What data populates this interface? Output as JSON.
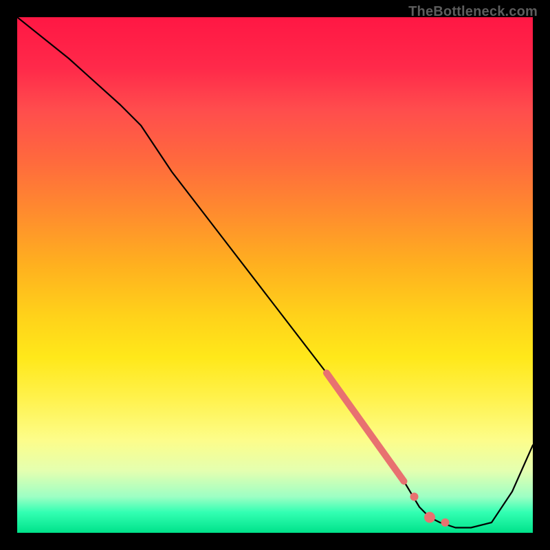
{
  "watermark": "TheBottleneck.com",
  "chart_data": {
    "type": "line",
    "xlim": [
      0,
      100
    ],
    "ylim": [
      0,
      100
    ],
    "grid": false,
    "legend": false,
    "title": "",
    "xlabel": "",
    "ylabel": "",
    "series": [
      {
        "name": "curve",
        "x": [
          0,
          10,
          20,
          24,
          30,
          40,
          50,
          60,
          68,
          72,
          75,
          78,
          80,
          82,
          85,
          88,
          92,
          96,
          100
        ],
        "y": [
          100,
          92,
          83,
          79,
          70,
          57,
          44,
          31,
          20,
          14,
          10,
          5,
          3,
          2,
          1,
          1,
          2,
          8,
          17
        ]
      }
    ],
    "markers": [
      {
        "name": "highlight-segment",
        "type": "segment",
        "x": [
          60,
          75
        ],
        "y": [
          31,
          10
        ],
        "width": 10,
        "color": "#e87170"
      },
      {
        "name": "pt1",
        "type": "dot",
        "x": 77,
        "y": 7,
        "r": 6,
        "color": "#e87170"
      },
      {
        "name": "pt2",
        "type": "dot",
        "x": 80,
        "y": 3,
        "r": 8,
        "color": "#e87170"
      },
      {
        "name": "pt3",
        "type": "dot",
        "x": 83,
        "y": 2,
        "r": 6,
        "color": "#e87170"
      }
    ]
  }
}
